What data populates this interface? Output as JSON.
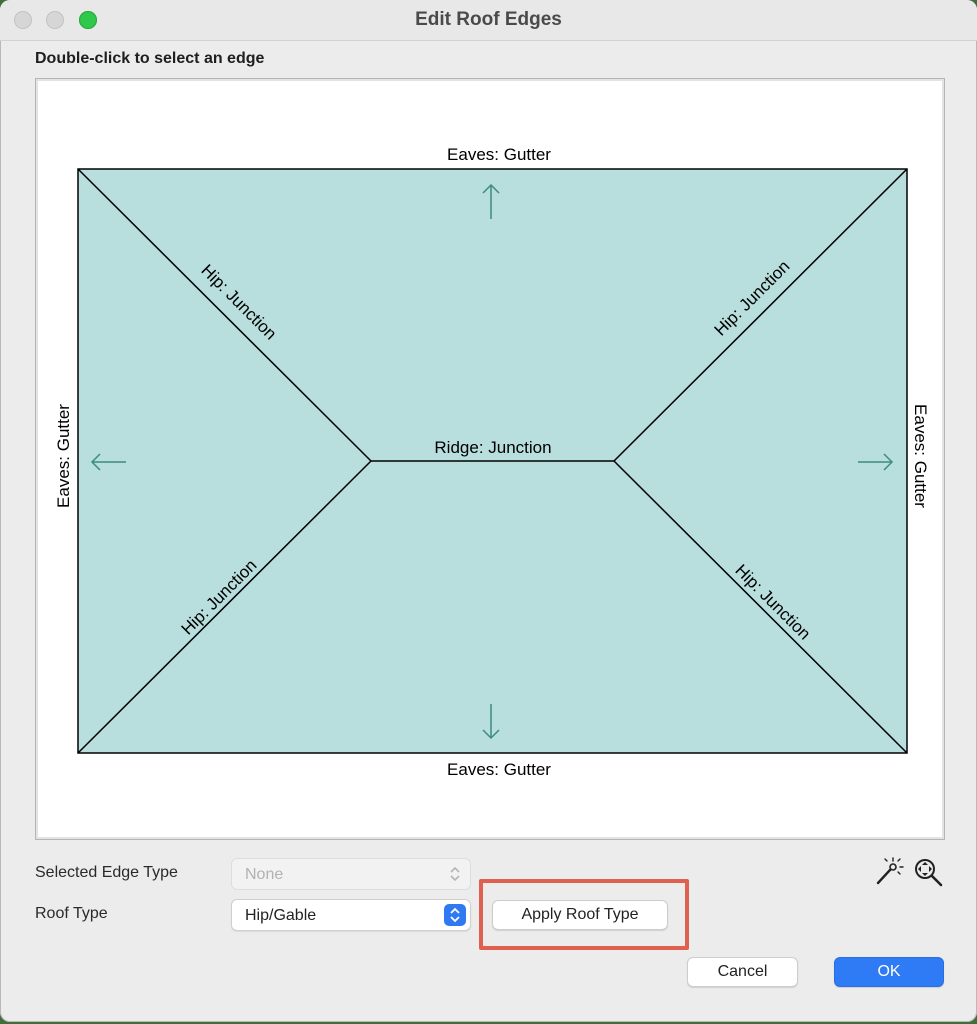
{
  "window": {
    "title": "Edit Roof Edges"
  },
  "instruction": "Double-click to select an edge",
  "diagram": {
    "top_edge": "Eaves: Gutter",
    "bottom_edge": "Eaves: Gutter",
    "left_edge": "Eaves: Gutter",
    "right_edge": "Eaves: Gutter",
    "ridge": "Ridge: Junction",
    "hip_top_left": "Hip: Junction",
    "hip_top_right": "Hip: Junction",
    "hip_bottom_left": "Hip: Junction",
    "hip_bottom_right": "Hip: Junction",
    "roof_fill_color": "#b8dedd",
    "arrow_color": "#3d8a80"
  },
  "form": {
    "selected_edge_type_label": "Selected Edge Type",
    "selected_edge_type_value": "None",
    "roof_type_label": "Roof Type",
    "roof_type_value": "Hip/Gable",
    "apply_label": "Apply Roof Type"
  },
  "tools": {
    "magic_wand_icon": "magic-wand-icon",
    "zoom_fit_icon": "zoom-fit-icon"
  },
  "buttons": {
    "cancel": "Cancel",
    "ok": "OK"
  },
  "colors": {
    "accent": "#2f7bf5",
    "highlight": "#e0604f"
  }
}
